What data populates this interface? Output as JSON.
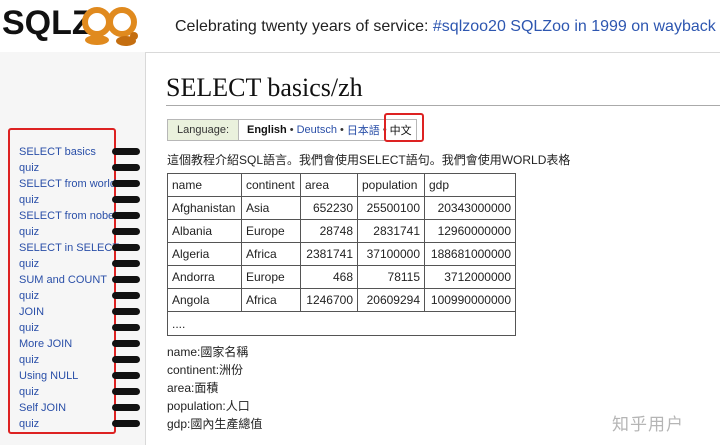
{
  "brand": {
    "logo_text": "SQLZOO"
  },
  "header": {
    "tagline_text": "Celebrating twenty years of service: ",
    "tagline_link": "#sqlzoo20 SQLZoo in 1999 on wayback"
  },
  "sidebar": {
    "items": [
      {
        "label": "SELECT basics"
      },
      {
        "label": "quiz"
      },
      {
        "label": "SELECT from world"
      },
      {
        "label": "quiz"
      },
      {
        "label": "SELECT from nobel"
      },
      {
        "label": "quiz"
      },
      {
        "label": "SELECT in SELECT"
      },
      {
        "label": "quiz"
      },
      {
        "label": "SUM and COUNT"
      },
      {
        "label": "quiz"
      },
      {
        "label": "JOIN"
      },
      {
        "label": "quiz"
      },
      {
        "label": "More JOIN"
      },
      {
        "label": "quiz"
      },
      {
        "label": "Using NULL"
      },
      {
        "label": "quiz"
      },
      {
        "label": "Self JOIN"
      },
      {
        "label": "quiz"
      }
    ]
  },
  "main": {
    "title": "SELECT basics/zh",
    "language": {
      "label": "Language:",
      "current": "English",
      "options": [
        "Deutsch",
        "日本語",
        "中文"
      ]
    },
    "intro": "這個教程介紹SQL語言。我們會使用SELECT語句。我們會使用WORLD表格",
    "table": {
      "headers": [
        "name",
        "continent",
        "area",
        "population",
        "gdp"
      ],
      "rows": [
        [
          "Afghanistan",
          "Asia",
          "652230",
          "25500100",
          "20343000000"
        ],
        [
          "Albania",
          "Europe",
          "28748",
          "2831741",
          "12960000000"
        ],
        [
          "Algeria",
          "Africa",
          "2381741",
          "37100000",
          "188681000000"
        ],
        [
          "Andorra",
          "Europe",
          "468",
          "78115",
          "3712000000"
        ],
        [
          "Angola",
          "Africa",
          "1246700",
          "20609294",
          "100990000000"
        ]
      ],
      "ellipsis": "...."
    },
    "definitions": [
      "name:國家名稱",
      "continent:洲份",
      "area:面積",
      "population:人口",
      "gdp:國內生產總值"
    ]
  },
  "watermark": "知乎用户",
  "colors": {
    "link": "#2a4fa8",
    "highlight_box": "#d22",
    "language_label_bg": "#eaf1dd",
    "logo_orange": "#e08a1e"
  }
}
